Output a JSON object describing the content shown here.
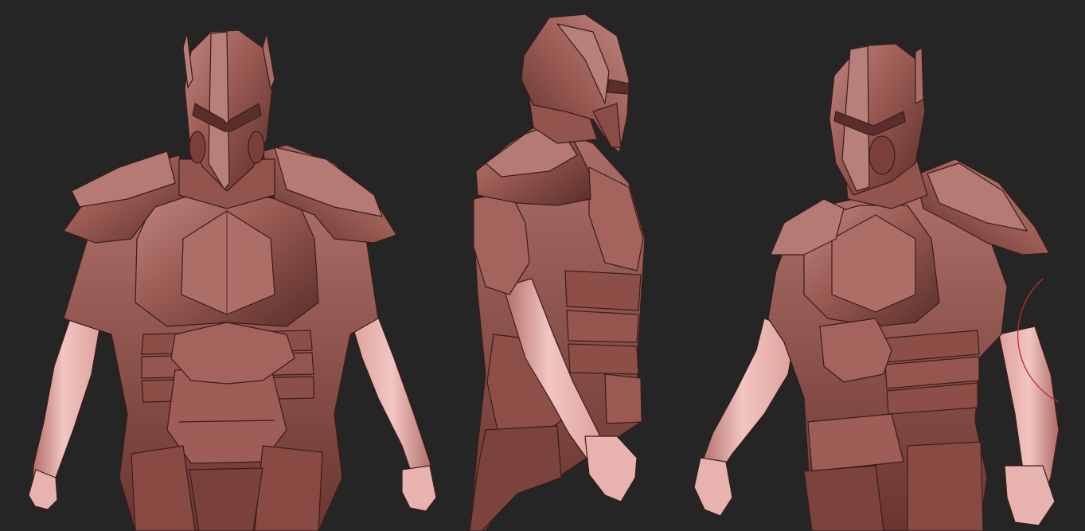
{
  "viewport": {
    "background": "#252525"
  },
  "palette": {
    "clay_base": "#9a5a53",
    "clay_light": "#c08580",
    "clay_dark": "#5a2e2a",
    "clay_mid": "#ad6e68",
    "skin_highlight": "#f2c6c3",
    "skin_mid": "#dd9f9a",
    "skin_shadow": "#b06a66",
    "outline": "#3a1c19",
    "brush_cursor": "#c62a2a"
  },
  "views": [
    {
      "id": "front",
      "icon": "armored-figure-front-view"
    },
    {
      "id": "side",
      "icon": "armored-figure-side-view"
    },
    {
      "id": "three-quarter",
      "icon": "armored-figure-three-quarter-view"
    }
  ],
  "brush_cursor": {
    "icon": "brush-cursor-circle"
  }
}
